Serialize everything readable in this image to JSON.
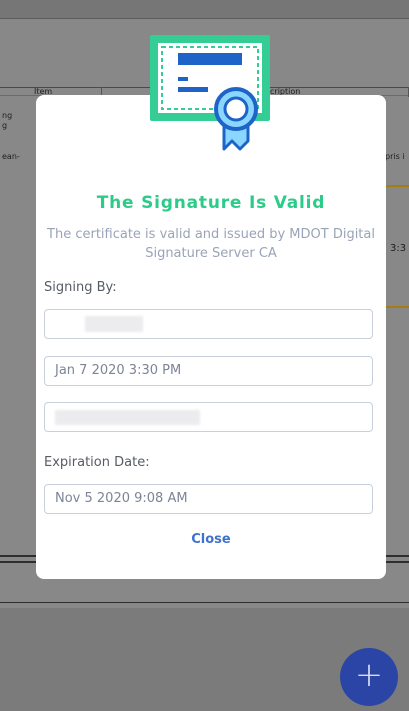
{
  "background": {
    "table_header": {
      "col_item": "Item",
      "col_description": "cription"
    },
    "rows": {
      "text_1": "ng",
      "text_2": "g",
      "text_3": "ean-",
      "text_4": "pris i",
      "text_5": "3:3"
    }
  },
  "dialog": {
    "title": "The Signature Is Valid",
    "description": "The certificate is valid and issued by MDOT Digital Signature Server CA",
    "signing_by_label": "Signing By:",
    "signer_name_value": "",
    "signed_date_value": "Jan 7 2020 3:30 PM",
    "signer_email_value": "",
    "expiration_label": "Expiration Date:",
    "expiration_value": "Nov 5 2020 9:08 AM",
    "close_label": "Close"
  },
  "fab": {
    "label": "+"
  },
  "colors": {
    "accent_green": "#2dcb8a",
    "link_blue": "#3f72ce",
    "fab_blue": "#2b45a6",
    "badge_blue": "#1e64c8"
  },
  "icons": {
    "badge": "certificate-icon",
    "fab": "plus-icon"
  }
}
